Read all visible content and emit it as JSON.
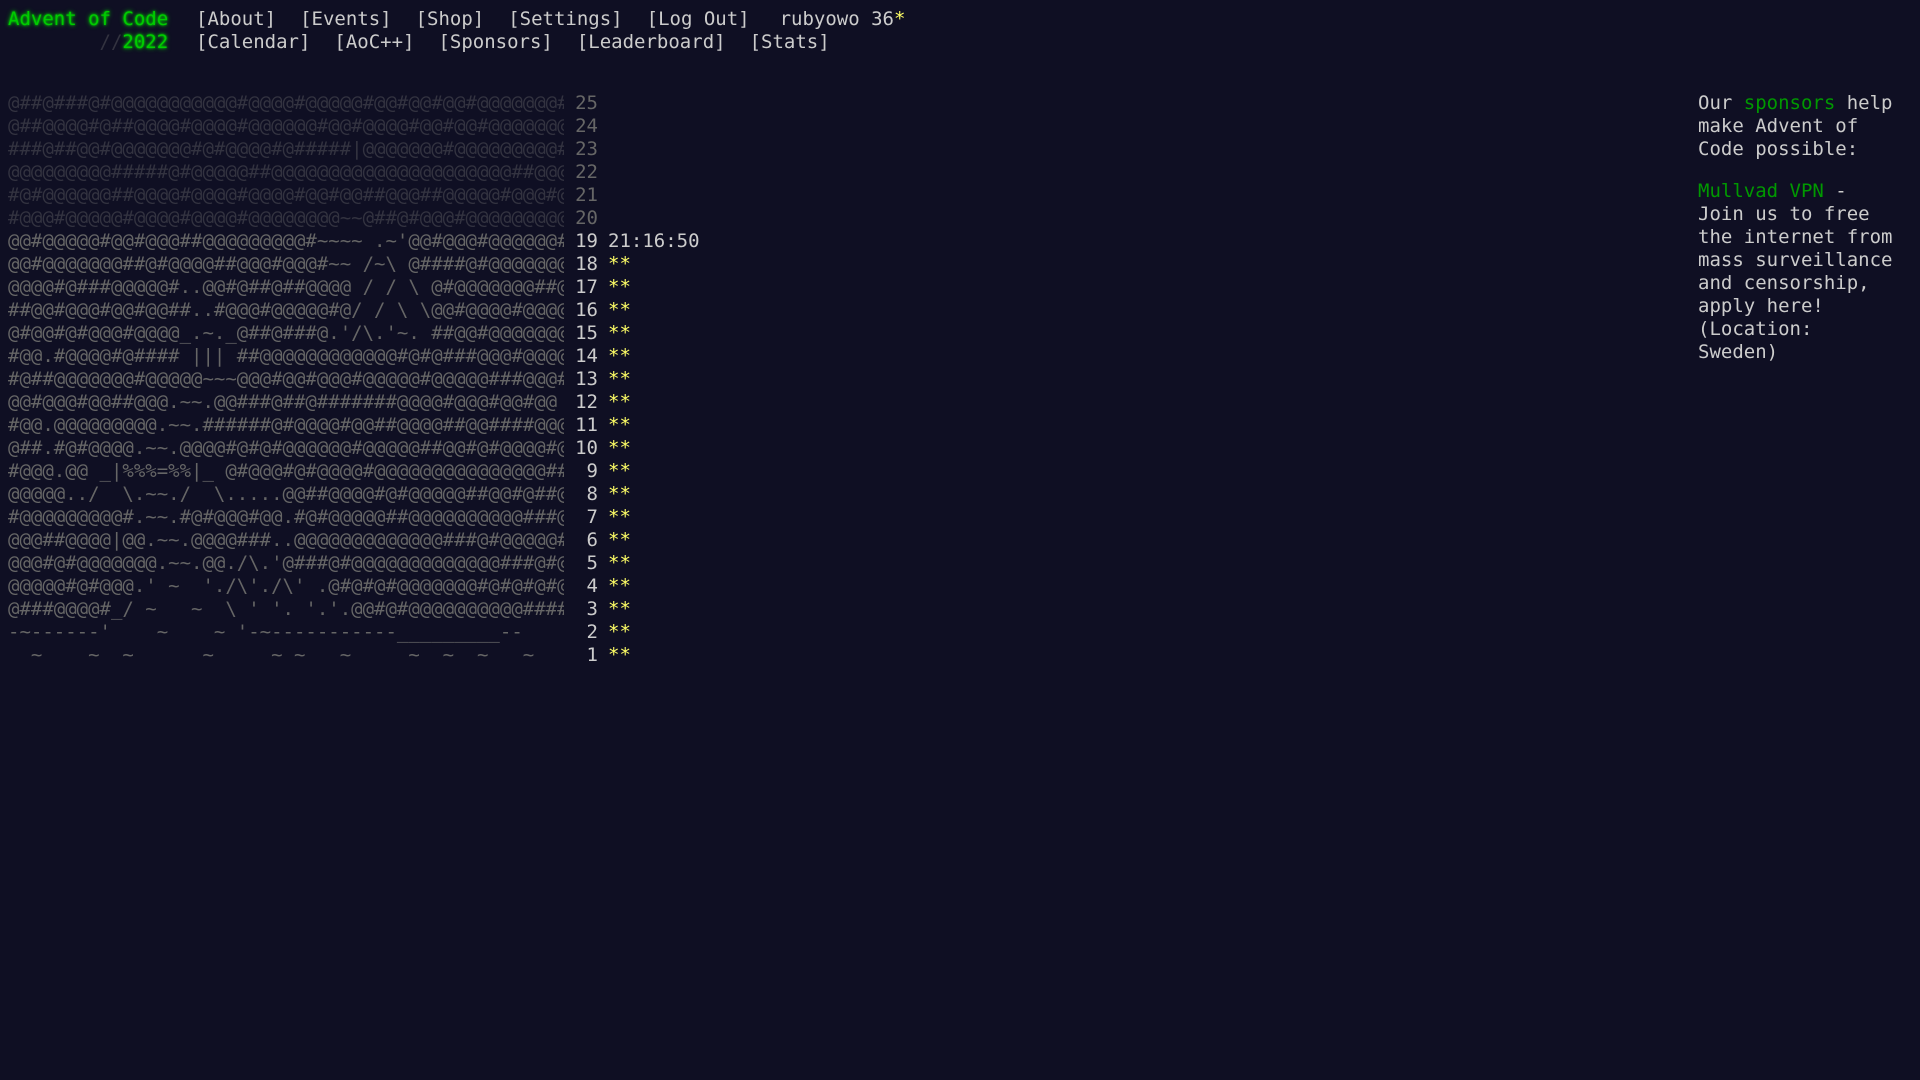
{
  "header": {
    "title": "Advent of Code",
    "year_prefix": "//",
    "year": "2022",
    "nav_top": [
      "[About]",
      "[Events]",
      "[Shop]",
      "[Settings]",
      "[Log Out]"
    ],
    "user_name": "rubyowo",
    "user_stars": "36",
    "user_star_glyph": "*",
    "nav_bottom": [
      "[Calendar]",
      "[AoC++]",
      "[Sponsors]",
      "[Leaderboard]",
      "[Stats]"
    ]
  },
  "calendar": {
    "rows": [
      {
        "day": "25",
        "art": "@##@###@#@@@@@@@@@@@#@@@@#@@@@@#@@#@@#@@#@@@@@@@##@@@",
        "state": "locked",
        "stars": "",
        "timer": ""
      },
      {
        "day": "24",
        "art": "@##@@@@#@##@@@@#@@@@#@@@@@@#@@#@@@@#@@#@@#@@@@@@@@@@@",
        "state": "locked",
        "stars": "",
        "timer": ""
      },
      {
        "day": "23",
        "art": "###@##@@#@@@@@@@#@#@@@@#@#####|@@@@@@@#@@@@@@@@@#@@@",
        "state": "locked",
        "stars": "",
        "timer": ""
      },
      {
        "day": "22",
        "art": "@@@@@@@@@#####@#@@@@@##@@@@@@@@@@@@@@@@@@@@@##@@@@@@",
        "state": "locked",
        "stars": "",
        "timer": ""
      },
      {
        "day": "21",
        "art": "#@#@@@@@@##@@@@#@@@@#@@@@#@@#@@##@@@##@@@@@#@@@#@@@@",
        "state": "locked",
        "stars": "",
        "timer": ""
      },
      {
        "day": "20",
        "art": "#@@@#@@@@@#@@@@#@@@@#@@@@@@@@~~@##@#@@@#@@@@@@@@@@@@",
        "state": "locked",
        "stars": "",
        "timer": ""
      },
      {
        "day": "19",
        "art": "@@#@@@@@#@@#@@@##@@@@@@@@@#~~~~ .~'@@#@@@#@@@@@@###@",
        "state": "current",
        "stars": "",
        "timer": "21:16:50"
      },
      {
        "day": "18",
        "art": "@@#@@@@@@@##@#@@@@##@@@#@@@#~~ /~\\ @####@#@@@@@@@",
        "state": "done",
        "stars": "**",
        "timer": ""
      },
      {
        "day": "17",
        "art": "@@@@#@###@@@@@#..@@#@##@##@@@@ / / \\ @#@@@@@@@##@@@",
        "state": "done",
        "stars": "**",
        "timer": ""
      },
      {
        "day": "16",
        "art": "##@@#@@@#@@#@@##..#@@@#@@@@@#@/ / \\ \\@@#@@@@#@@@@@",
        "state": "done",
        "stars": "**",
        "timer": ""
      },
      {
        "day": "15",
        "art": "@#@@#@#@@@#@@@@_.~._@##@###@.'/\\.'~. ##@@#@@@@@@@#",
        "state": "done",
        "stars": "**",
        "timer": ""
      },
      {
        "day": "14",
        "art": "#@@.#@@@@#@#### ||| ##@@@@@@@@@@@@#@#@###@@@#@@@@@@",
        "state": "done",
        "stars": "**",
        "timer": ""
      },
      {
        "day": "13",
        "art": "#@##@@@@@@@#@@@@@~~~@@@#@@#@@@#@@@@@#@@@@@###@@@##@",
        "state": "done",
        "stars": "**",
        "timer": ""
      },
      {
        "day": "12",
        "art": "@@#@@@#@@##@@@.~~.@@###@##@#######@@@@#@@@#@@#@@",
        "state": "done",
        "stars": "**",
        "timer": ""
      },
      {
        "day": "11",
        "art": "#@@.@@@@@@@@@.~~.######@#@@@@#@@##@@@@##@@####@@@@",
        "state": "done",
        "stars": "**",
        "timer": ""
      },
      {
        "day": "10",
        "art": "@##.#@#@@@@.~~.@@@@#@#@#@@@@@@#@@@@@##@@#@#@@@@#@#",
        "state": "done",
        "stars": "**",
        "timer": ""
      },
      {
        "day": "9",
        "art": "#@@@.@@ _|%%%=%%|_ @#@@@#@#@@@@#@@@@@@@@@@@@@@@###@",
        "state": "done",
        "stars": "**",
        "timer": ""
      },
      {
        "day": "8",
        "art": "@@@@@../  \\.~~./  \\.....@@##@@@@#@#@@@@@##@@#@##@",
        "state": "done",
        "stars": "**",
        "timer": ""
      },
      {
        "day": "7",
        "art": "#@@@@@@@@@#.~~.#@#@@@#@@.#@#@@@@@##@@@@@@@@@@###@@",
        "state": "done",
        "stars": "**",
        "timer": ""
      },
      {
        "day": "6",
        "art": "@@@##@@@@|@@.~~.@@@@###..@@@@@@@@@@@@@###@#@@@@@##@@",
        "state": "done",
        "stars": "**",
        "timer": ""
      },
      {
        "day": "5",
        "art": "@@@#@#@@@@@@@.~~.@@./\\.'@###@#@@@@@@@@@@@@@###@#@",
        "state": "done",
        "stars": "**",
        "timer": ""
      },
      {
        "day": "4",
        "art": "@@@@@#@#@@@.' ~  './\\'./\\' .@#@#@#@@@@@@@#@#@#@#@@",
        "state": "done",
        "stars": "**",
        "timer": ""
      },
      {
        "day": "3",
        "art": "@###@@@@#_/ ~   ~  \\ ' '. '.'.@@#@#@@@@@@@@@@#####",
        "state": "done",
        "stars": "**",
        "timer": ""
      },
      {
        "day": "2",
        "art": "-~------'    ~    ~ '-~-----------_________--",
        "state": "done",
        "stars": "**",
        "timer": ""
      },
      {
        "day": "1",
        "art": "  ~    ~  ~      ~     ~ ~   ~     ~  ~  ~   ~",
        "state": "done",
        "stars": "**",
        "timer": ""
      }
    ]
  },
  "sidebar": {
    "intro_before": "Our ",
    "intro_link": "sponsors",
    "intro_after": " help make Advent of Code possible:",
    "sponsor_name": "Mullvad VPN",
    "sponsor_text": " - Join us to free the internet from mass surveillance and censorship, apply here! (Location: Sweden)"
  },
  "colors": {
    "background": "#0f0f23",
    "text": "#cccccc",
    "accent_green": "#00cc00",
    "link_green": "#009900",
    "star_yellow": "#ffff66"
  }
}
